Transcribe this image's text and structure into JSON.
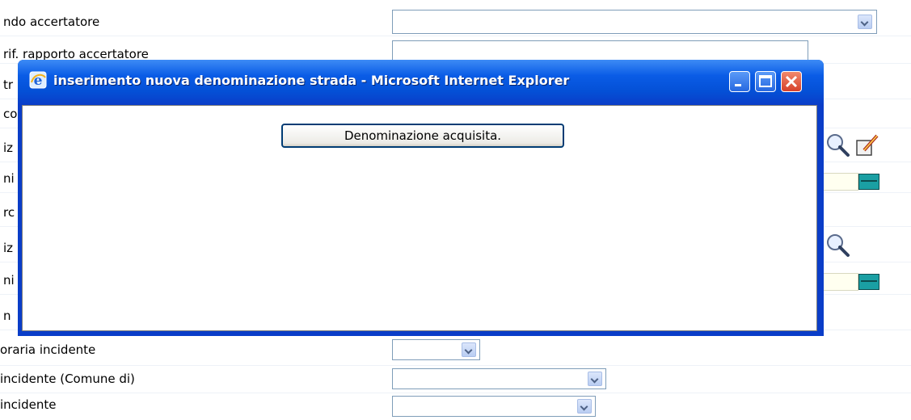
{
  "form": {
    "rows": [
      {
        "label": "ndo accertatore"
      },
      {
        "label": "rif. rapporto accertatore"
      },
      {
        "label": "tr"
      },
      {
        "label": "co"
      },
      {
        "label": "iz"
      },
      {
        "label": "ni"
      },
      {
        "label": "rc"
      },
      {
        "label": "iz"
      },
      {
        "label": "ni"
      },
      {
        "label": "n"
      },
      {
        "label": "oraria incidente"
      },
      {
        "label": "incidente (Comune di)"
      },
      {
        "label": "incidente"
      }
    ]
  },
  "popup": {
    "title": "inserimento nuova denominazione strada - Microsoft Internet Explorer",
    "message_button": "Denominazione acquisita."
  },
  "icons": {
    "title_icon": "ie-icon",
    "search": "magnifier-icon",
    "edit": "edit-pen-icon",
    "calendar": "calendar-icon"
  }
}
